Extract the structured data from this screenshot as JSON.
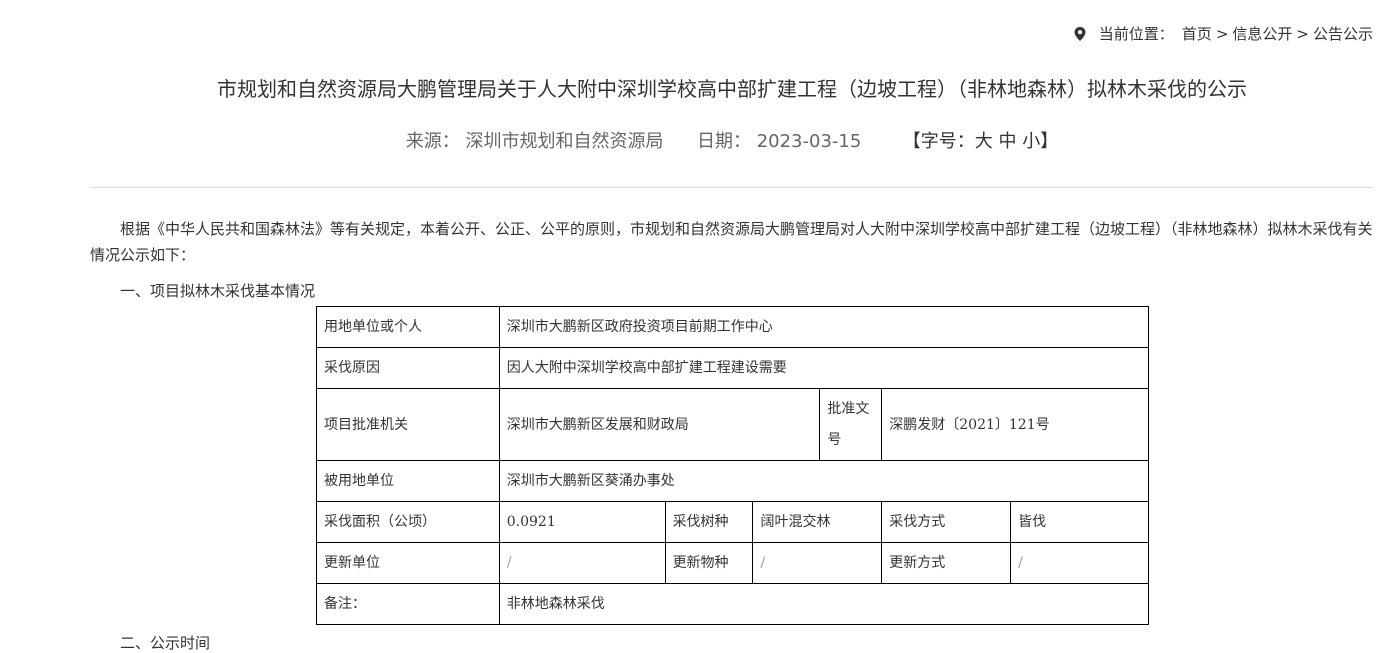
{
  "breadcrumb": {
    "prefix": "当前位置：",
    "items": [
      "首页",
      "信息公开",
      "公告公示"
    ],
    "separator": ">"
  },
  "article": {
    "title": "市规划和自然资源局大鹏管理局关于人大附中深圳学校高中部扩建工程（边坡工程）（非林地森林）拟林木采伐的公示",
    "meta": {
      "source_label": "来源：",
      "source": "深圳市规划和自然资源局",
      "date_label": "日期：",
      "date": "2023-03-15",
      "font_size_label_open": "【字号：",
      "font_large": "大",
      "font_medium": "中",
      "font_small": "小",
      "font_size_label_close": "】"
    },
    "intro": "根据《中华人民共和国森林法》等有关规定，本着公开、公正、公平的原则，市规划和自然资源局大鹏管理局对人大附中深圳学校高中部扩建工程（边坡工程）（非林地森林）拟林木采伐有关情况公示如下：",
    "section1_heading": "一、项目拟林木采伐基本情况",
    "table": {
      "land_user_label": "用地单位或个人",
      "land_user": "深圳市大鹏新区政府投资项目前期工作中心",
      "reason_label": "采伐原因",
      "reason": "因人大附中深圳学校高中部扩建工程建设需要",
      "approval_authority_label": "项目批准机关",
      "approval_authority": "深圳市大鹏新区发展和财政局",
      "approval_doc_label": "批准文号",
      "approval_doc": "深鹏发财〔2021〕121号",
      "occupied_unit_label": "被用地单位",
      "occupied_unit": "深圳市大鹏新区葵涌办事处",
      "area_label": "采伐面积（公顷）",
      "area": "0.0921",
      "tree_species_label": "采伐树种",
      "tree_species": "阔叶混交林",
      "method_label": "采伐方式",
      "method": "皆伐",
      "renew_unit_label": "更新单位",
      "renew_unit": "/",
      "renew_species_label": "更新物种",
      "renew_species": "/",
      "renew_method_label": "更新方式",
      "renew_method": "/",
      "remark_label": "备注：",
      "remark": "非林地森林采伐"
    },
    "section2_heading": "二、公示时间"
  }
}
